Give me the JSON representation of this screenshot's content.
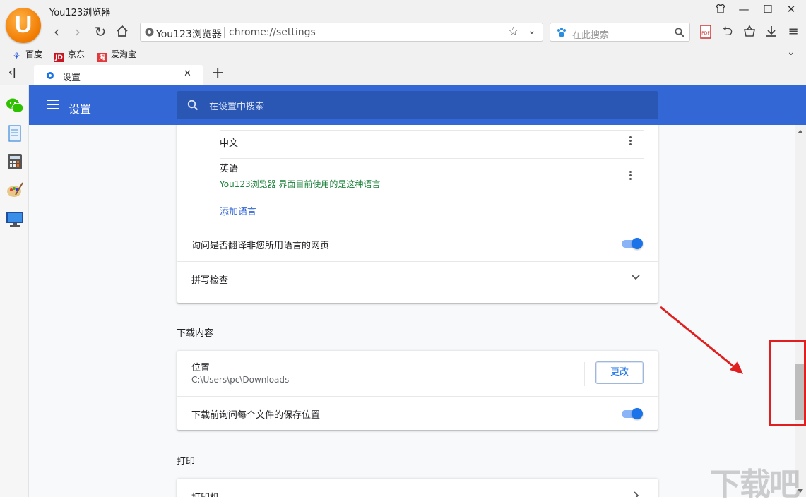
{
  "app": {
    "title": "You123浏览器"
  },
  "address_bar": {
    "site_label": "You123浏览器",
    "url": "chrome://settings"
  },
  "search_bar": {
    "placeholder": "在此搜索"
  },
  "bookmarks": [
    {
      "label": "百度",
      "icon": "baidu-paw-icon",
      "color": "#2a5ad8"
    },
    {
      "label": "京东",
      "icon": "jd-icon",
      "color": "#c81623",
      "badge": "JD"
    },
    {
      "label": "爱淘宝",
      "icon": "taobao-icon",
      "color": "#e4393c",
      "badge": "淘"
    }
  ],
  "tab": {
    "label": "设置"
  },
  "settings": {
    "header_title": "设置",
    "search_placeholder": "在设置中搜索",
    "languages": {
      "items": [
        {
          "name": "中文",
          "note": ""
        },
        {
          "name": "英语",
          "note": "You123浏览器 界面目前使用的是这种语言"
        }
      ],
      "add_language": "添加语言",
      "ask_translate": "询问是否翻译非您所用语言的网页",
      "ask_translate_on": true,
      "spell_check": "拼写检查"
    },
    "downloads": {
      "section_title": "下载内容",
      "location_label": "位置",
      "location_path": "C:\\Users\\pc\\Downloads",
      "change_button": "更改",
      "ask_where": "下载前询问每个文件的保存位置",
      "ask_where_on": true
    },
    "printing": {
      "section_title": "打印",
      "printers_label": "打印机"
    }
  },
  "colors": {
    "accent": "#3367d6",
    "toggle": "#1a73e8",
    "annotation": "#e02020",
    "note_green": "#188038",
    "link": "#3367d6"
  },
  "watermark": "下载吧"
}
